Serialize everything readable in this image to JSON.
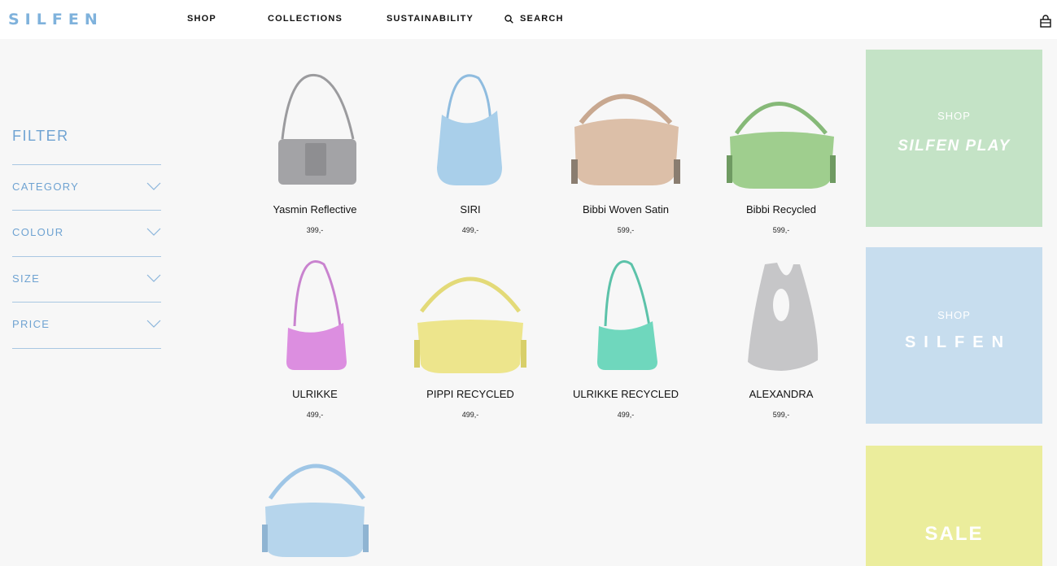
{
  "header": {
    "logo": "SILFEN",
    "nav": {
      "shop": "SHOP",
      "collections": "COLLECTIONS",
      "sustainability": "SUSTAINABILITY",
      "search": "SEARCH"
    }
  },
  "filter": {
    "title": "FILTER",
    "items": [
      {
        "label": "CATEGORY"
      },
      {
        "label": "COLOUR"
      },
      {
        "label": "SIZE"
      },
      {
        "label": "PRICE"
      }
    ]
  },
  "products": [
    {
      "name": "Yasmin Reflective",
      "price": "399,-",
      "color": "#a3a3a6"
    },
    {
      "name": "SIRI",
      "price": "499,-",
      "color": "#a9cfea"
    },
    {
      "name": "Bibbi Woven Satin",
      "price": "599,-",
      "color": "#dcbfa8"
    },
    {
      "name": "Bibbi Recycled",
      "price": "599,-",
      "color": "#9fce8e"
    },
    {
      "name": "ULRIKKE",
      "price": "499,-",
      "color": "#dc8ee0"
    },
    {
      "name": "PIPPI RECYCLED",
      "price": "499,-",
      "color": "#ede58c"
    },
    {
      "name": "ULRIKKE RECYCLED",
      "price": "499,-",
      "color": "#6fd7bd"
    },
    {
      "name": "ALEXANDRA",
      "price": "599,-",
      "color": "#c6c6c8"
    },
    {
      "name": "",
      "price": "",
      "color": "#b6d5ec"
    }
  ],
  "promos": {
    "play": {
      "shop": "SHOP",
      "brand": "SILFEN PLAY",
      "color": "#c4e3c6"
    },
    "silfen": {
      "shop": "SHOP",
      "brand": "SILFEN",
      "color": "#c7ddee"
    },
    "sale": {
      "label": "SALE",
      "color": "#ebed9c"
    }
  },
  "colors": {
    "accent": "#6fa3d2",
    "logo": "#7fb2dc"
  }
}
